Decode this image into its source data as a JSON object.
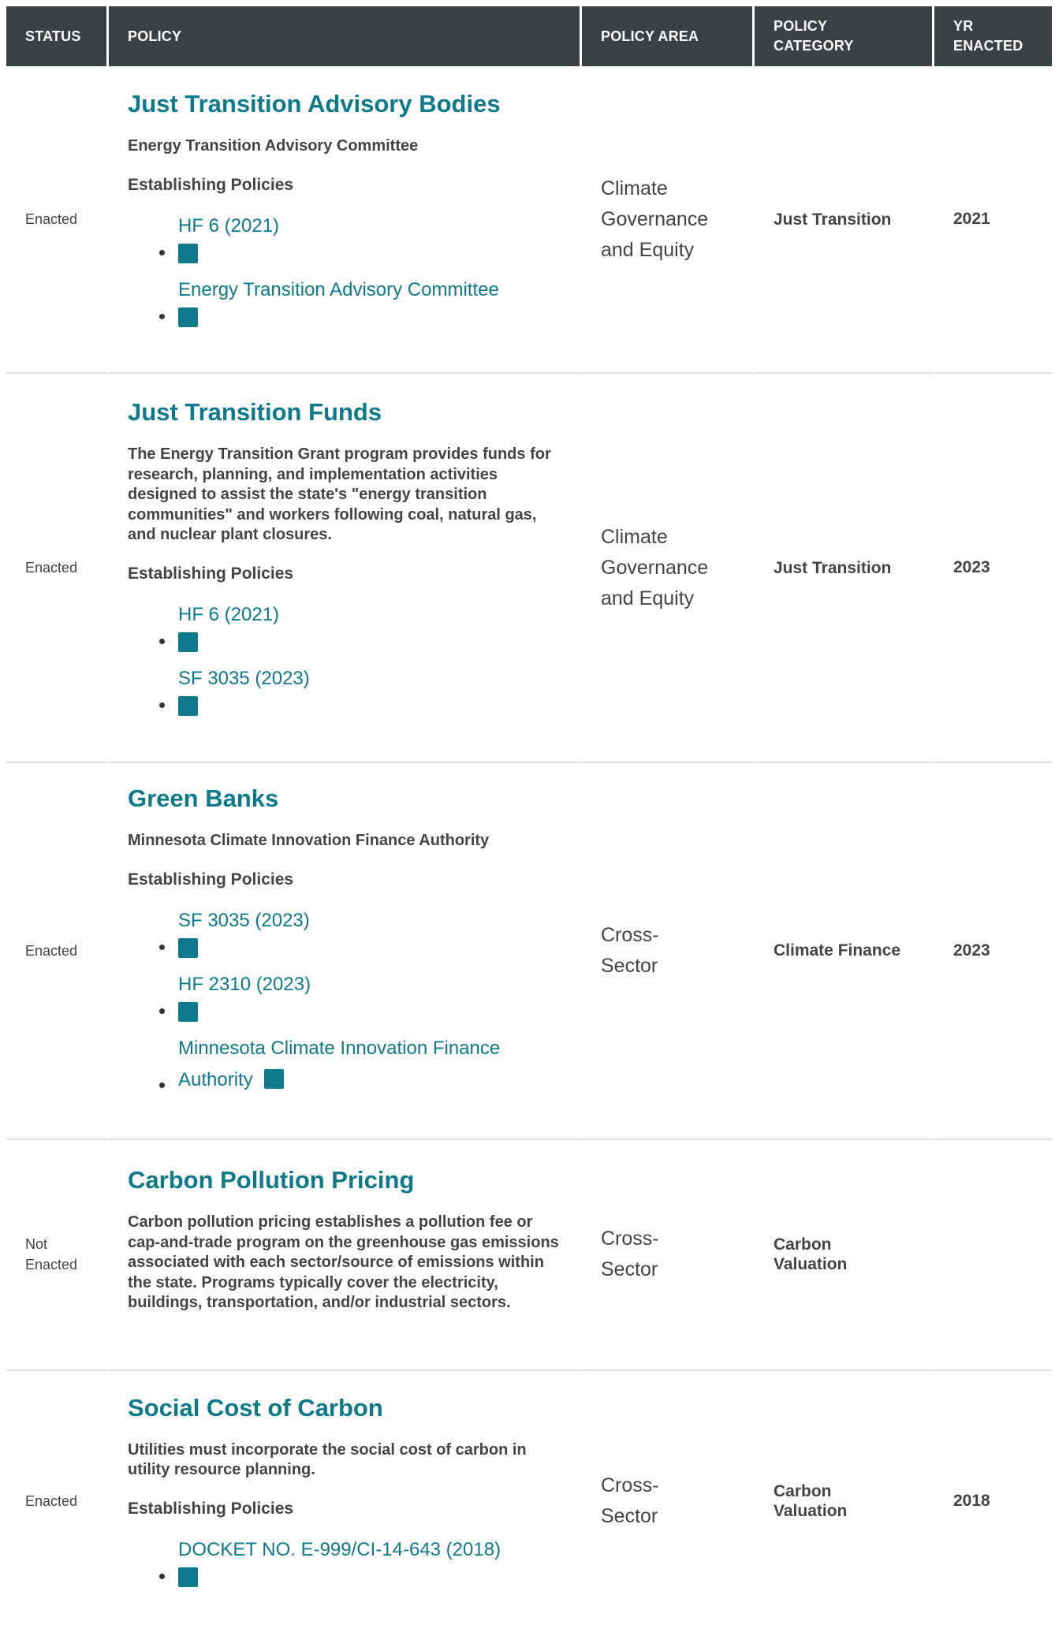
{
  "table": {
    "headers": {
      "status": "STATUS",
      "policy": "POLICY",
      "area": "POLICY AREA",
      "category_line1": "POLICY",
      "category_line2": "CATEGORY",
      "year_line1": "YR",
      "year_line2": "ENACTED"
    },
    "rows": [
      {
        "status": "Enacted",
        "title": "Just Transition Advisory Bodies",
        "description": "Energy Transition Advisory Committee",
        "establishing_label": "Establishing Policies",
        "links": [
          "HF 6 (2021)",
          "Energy Transition Advisory Committee"
        ],
        "area_line1": "Climate",
        "area_line2": "Governance",
        "area_line3": "and Equity",
        "category": "Just Transition",
        "year": "2021"
      },
      {
        "status": "Enacted",
        "title": "Just Transition Funds",
        "description": "The Energy Transition Grant program provides funds for research, planning, and implementation activities designed to assist the state's \"energy transition communities\" and workers following coal, natural gas, and nuclear plant closures.",
        "establishing_label": "Establishing Policies",
        "links": [
          "HF 6 (2021)",
          "SF 3035 (2023)"
        ],
        "area_line1": "Climate",
        "area_line2": "Governance",
        "area_line3": "and Equity",
        "category": "Just Transition",
        "year": "2023"
      },
      {
        "status": "Enacted",
        "title": "Green Banks",
        "description": "Minnesota Climate Innovation Finance Authority",
        "establishing_label": "Establishing Policies",
        "links": [
          "SF 3035 (2023)",
          "HF 2310 (2023)"
        ],
        "link_wrapped_line1": "Minnesota Climate Innovation Finance",
        "link_wrapped_line2": "Authority",
        "area_line1": "Cross-",
        "area_line2": "Sector",
        "category": "Climate Finance",
        "year": "2023"
      },
      {
        "status_line1": "Not",
        "status_line2": "Enacted",
        "title": "Carbon Pollution Pricing",
        "description": "Carbon pollution pricing establishes a pollution fee or cap-and-trade program on the greenhouse gas emissions associated with each sector/source of emissions within the state. Programs typically cover the electricity, buildings, transportation, and/or industrial sectors.",
        "area_line1": "Cross-",
        "area_line2": "Sector",
        "category_line1": "Carbon",
        "category_line2": "Valuation",
        "year": ""
      },
      {
        "status": "Enacted",
        "title": "Social Cost of Carbon",
        "description": "Utilities must incorporate the social cost of carbon in utility resource planning.",
        "establishing_label": "Establishing Policies",
        "links": [
          "DOCKET NO. E-999/CI-14-643 (2018)"
        ],
        "area_line1": "Cross-",
        "area_line2": "Sector",
        "category_line1": "Carbon",
        "category_line2": "Valuation",
        "year": "2018"
      }
    ]
  },
  "icons": {
    "document": "document-icon"
  },
  "colors": {
    "header_bg": "#3b4143",
    "link": "#0c7a8a",
    "divider": "#dedede"
  }
}
